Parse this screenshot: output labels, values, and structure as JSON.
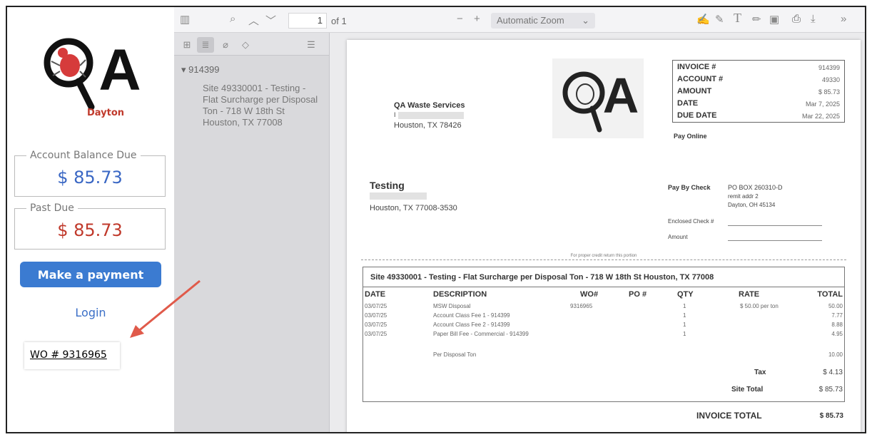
{
  "portal": {
    "brand_text": "Dayton",
    "logo_letter": "A",
    "account_balance": {
      "label": "Account Balance Due",
      "amount": "$ 85.73"
    },
    "past_due": {
      "label": "Past Due",
      "amount": "$ 85.73"
    },
    "payment_button": "Make a payment",
    "login_link": "Login",
    "annotation": "WO # 9316965",
    "colors": {
      "balance": "#3a67c4",
      "past_due": "#c0392b",
      "button": "#3b7bd1",
      "arrow": "#e05a4a"
    }
  },
  "viewer": {
    "toolbar": {
      "page_number": "1",
      "page_count": "of 1",
      "zoom": "Automatic Zoom",
      "icons": [
        "sidebar-toggle-icon",
        "search-icon",
        "chevron-up-icon",
        "chevron-down-icon",
        "minus-icon",
        "plus-icon",
        "signature-icon",
        "highlight-icon",
        "text-icon",
        "draw-icon",
        "image-icon",
        "print-icon",
        "save-icon",
        "more-icon"
      ]
    },
    "sidebar": {
      "tabs": [
        "thumbnails-icon",
        "outline-icon",
        "attachments-icon",
        "layers-icon"
      ],
      "outline_root": "914399",
      "outline_item": "Site 49330001 - Testing - Flat Surcharge per Disposal Ton - 718 W 18th St Houston, TX 77008"
    }
  },
  "invoice": {
    "from": {
      "name": "QA Waste Services",
      "line1": "I",
      "city": "Houston, TX 78426"
    },
    "meta": [
      {
        "label": "INVOICE #",
        "value": "914399"
      },
      {
        "label": "ACCOUNT #",
        "value": "49330"
      },
      {
        "label": "AMOUNT",
        "value": "$ 85.73"
      },
      {
        "label": "DATE",
        "value": "Mar 7, 2025"
      },
      {
        "label": "DUE DATE",
        "value": "Mar 22, 2025"
      }
    ],
    "pay_online": "Pay Online",
    "to": {
      "name": "Testing",
      "city": "Houston, TX 77008-3530"
    },
    "pay_by_check": {
      "label": "Pay By Check",
      "line1": "PO BOX 260310-D",
      "line2": "remit addr 2",
      "line3": "Dayton, OH 45134",
      "enclosed_label": "Enclosed Check #",
      "amount_label": "Amount"
    },
    "credit_note": "For proper credit return this portion",
    "site_title": "Site 49330001 - Testing - Flat Surcharge per Disposal Ton - 718 W 18th St Houston, TX 77008",
    "columns": [
      "DATE",
      "DESCRIPTION",
      "WO#",
      "PO #",
      "QTY",
      "RATE",
      "TOTAL"
    ],
    "rows": [
      {
        "date": "03/07/25",
        "desc": "MSW Disposal",
        "wo": "9316965",
        "qty": "1",
        "rate": "$ 50.00 per ton",
        "total": "50.00"
      },
      {
        "date": "03/07/25",
        "desc": "Account Class Fee 1 - 914399",
        "wo": "",
        "qty": "1",
        "rate": "",
        "total": "7.77"
      },
      {
        "date": "03/07/25",
        "desc": "Account Class Fee 2 - 914399",
        "wo": "",
        "qty": "1",
        "rate": "",
        "total": "8.88"
      },
      {
        "date": "03/07/25",
        "desc": "Paper Bill Fee - Commercial - 914399",
        "wo": "",
        "qty": "1",
        "rate": "",
        "total": "4.95"
      },
      {
        "date": "",
        "desc": "Per Disposal Ton",
        "wo": "",
        "qty": "",
        "rate": "",
        "total": "10.00"
      }
    ],
    "tax": {
      "label": "Tax",
      "value": "$ 4.13"
    },
    "site_total": {
      "label": "Site Total",
      "value": "$ 85.73"
    },
    "invoice_total": {
      "label": "INVOICE TOTAL",
      "value": "$ 85.73"
    }
  }
}
